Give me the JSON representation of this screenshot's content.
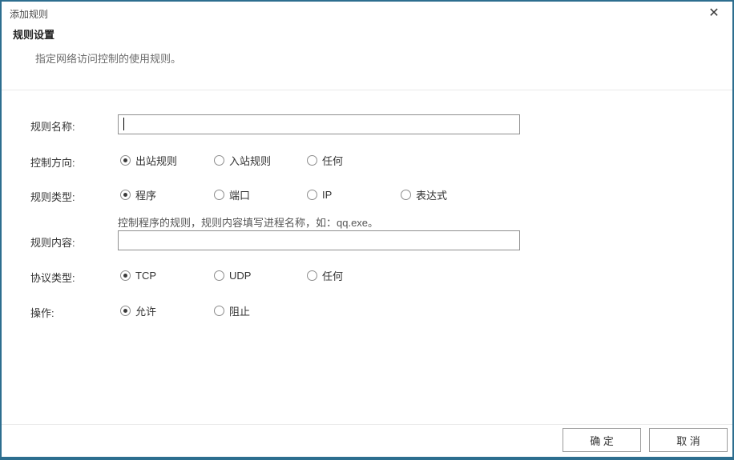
{
  "dialog": {
    "title": "添加规则",
    "close_icon": "✕"
  },
  "header": {
    "section_title": "规则设置",
    "description": "指定网络访问控制的使用规则。"
  },
  "form": {
    "rule_name": {
      "label": "规则名称:",
      "value": "",
      "focused": true
    },
    "direction": {
      "label": "控制方向:",
      "options": [
        {
          "label": "出站规则",
          "selected": true
        },
        {
          "label": "入站规则",
          "selected": false
        },
        {
          "label": "任何",
          "selected": false
        }
      ]
    },
    "rule_type": {
      "label": "规则类型:",
      "options": [
        {
          "label": "程序",
          "selected": true
        },
        {
          "label": "端口",
          "selected": false
        },
        {
          "label": "IP",
          "selected": false
        },
        {
          "label": "表达式",
          "selected": false
        }
      ],
      "hint": "控制程序的规则，规则内容填写进程名称，如：qq.exe。"
    },
    "rule_content": {
      "label": "规则内容:",
      "value": ""
    },
    "protocol": {
      "label": "协议类型:",
      "options": [
        {
          "label": "TCP",
          "selected": true
        },
        {
          "label": "UDP",
          "selected": false
        },
        {
          "label": "任何",
          "selected": false
        }
      ]
    },
    "action": {
      "label": "操作:",
      "options": [
        {
          "label": "允许",
          "selected": true
        },
        {
          "label": "阻止",
          "selected": false
        }
      ]
    }
  },
  "footer": {
    "ok_label": "确 定",
    "cancel_label": "取 消"
  },
  "colors": {
    "frame": "#2d6e8f",
    "divider": "#e9e9e9",
    "input_border": "#8f8f8f",
    "button_border": "#9b9b9b",
    "text": "#333333",
    "muted_text": "#666666"
  }
}
